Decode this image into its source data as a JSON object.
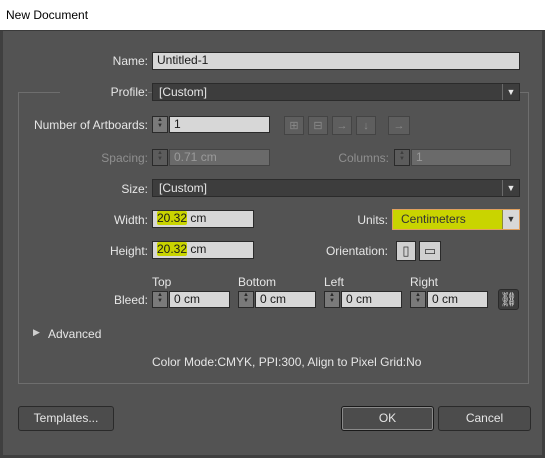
{
  "window": {
    "title": "New Document"
  },
  "form": {
    "name_label": "Name:",
    "name_value": "Untitled-1",
    "profile_label": "Profile:",
    "profile_value": "[Custom]",
    "artboards_label": "Number of Artboards:",
    "artboards_value": "1",
    "spacing_label": "Spacing:",
    "spacing_value": "0.71 cm",
    "columns_label": "Columns:",
    "columns_value": "1",
    "size_label": "Size:",
    "size_value": "[Custom]",
    "width_label": "Width:",
    "width_number": "20.32",
    "width_unit": "cm",
    "units_label": "Units:",
    "units_value": "Centimeters",
    "height_label": "Height:",
    "height_number": "20.32",
    "height_unit": "cm",
    "orientation_label": "Orientation:",
    "bleed_label": "Bleed:",
    "bleed": {
      "top_label": "Top",
      "top_value": "0 cm",
      "bottom_label": "Bottom",
      "bottom_value": "0 cm",
      "left_label": "Left",
      "left_value": "0 cm",
      "right_label": "Right",
      "right_value": "0 cm"
    },
    "advanced_label": "Advanced",
    "info_text": "Color Mode:CMYK, PPI:300, Align to Pixel Grid:No"
  },
  "buttons": {
    "templates": "Templates...",
    "ok": "OK",
    "cancel": "Cancel"
  },
  "icons": {
    "arrange_icons": [
      "grid-by-row-icon",
      "grid-by-column-icon",
      "arrange-by-row-icon",
      "arrange-by-column-icon",
      "right-to-left-icon"
    ],
    "orientation_icons": [
      "portrait-icon",
      "landscape-icon"
    ],
    "link_icon": "chain-link-icon"
  },
  "colors": {
    "highlight": "#c9d400",
    "units_border": "#e0a060"
  }
}
